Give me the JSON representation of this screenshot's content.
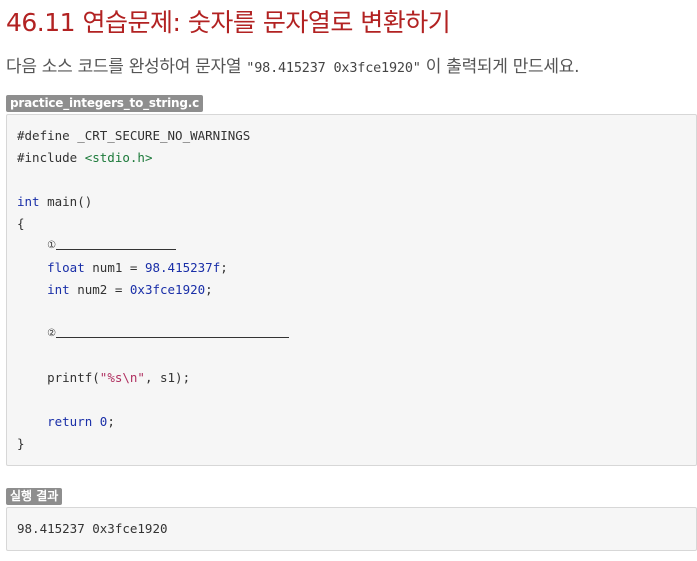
{
  "heading": {
    "number": "46.11",
    "text": "연습문제: 숫자를 문자열로 변환하기"
  },
  "description": {
    "before": "다음 소스 코드를 완성하여 문자열 ",
    "code": "\"98.415237 0x3fce1920\"",
    "after": " 이 출력되게 만드세요."
  },
  "source_file": {
    "name": "practice_integers_to_string.c",
    "lines": {
      "l1": "#define _CRT_SECURE_NO_WARNINGS",
      "l2_directive": "#include ",
      "l2_header": "<stdio.h>",
      "l4_type": "int",
      "l4_rest": " main()",
      "l5": "{",
      "l6_marker": "①",
      "l7_type": "float",
      "l7_mid": " num1 = ",
      "l7_num": "98.415237f",
      "l7_end": ";",
      "l8_type": "int",
      "l8_mid": " num2 = ",
      "l8_num": "0x3fce1920",
      "l8_end": ";",
      "l10_marker": "②",
      "l12_fn": "printf(",
      "l12_str": "\"%s\\n\"",
      "l12_rest": ", s1);",
      "l14_kw": "return",
      "l14_sp": " ",
      "l14_num": "0",
      "l14_end": ";",
      "l15": "}"
    }
  },
  "result": {
    "label": "실행 결과",
    "output": "98.415237 0x3fce1920"
  }
}
